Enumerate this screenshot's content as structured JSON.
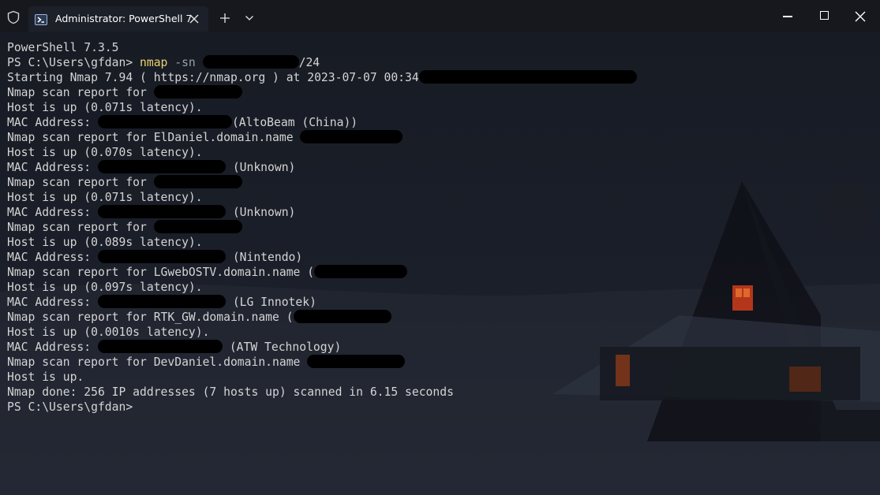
{
  "tab": {
    "title": "Administrator: PowerShell 7"
  },
  "terminal": {
    "lines": [
      "PowerShell 7.3.5",
      "Starting Nmap 7.94 ( https://nmap.org ) at 2023-07-07 00:34",
      "Nmap scan report for",
      "Host is up (0.071s latency).",
      "MAC Address:",
      "(AltoBeam (China))",
      "Nmap scan report for ElDaniel.domain.name",
      "Host is up (0.070s latency).",
      "MAC Address:",
      "(Unknown)",
      "Nmap scan report for",
      "Host is up (0.071s latency).",
      "MAC Address:",
      "(Unknown)",
      "Nmap scan report for",
      "Host is up (0.089s latency).",
      "MAC Address:",
      "(Nintendo)",
      "Nmap scan report for LGwebOSTV.domain.name (",
      "Host is up (0.097s latency).",
      "MAC Address:",
      "(LG Innotek)",
      "Nmap scan report for RTK_GW.domain.name (",
      "Host is up (0.0010s latency).",
      "MAC Address:",
      "(ATW Technology)",
      "Nmap scan report for DevDaniel.domain.name",
      "Host is up.",
      "Nmap done: 256 IP addresses (7 hosts up) scanned in 6.15 seconds",
      "PS C:\\Users\\gfdan>"
    ],
    "prompt": "PS C:\\Users\\gfdan>",
    "command": "nmap",
    "flag": "-sn",
    "subnet_suffix": "/24"
  }
}
